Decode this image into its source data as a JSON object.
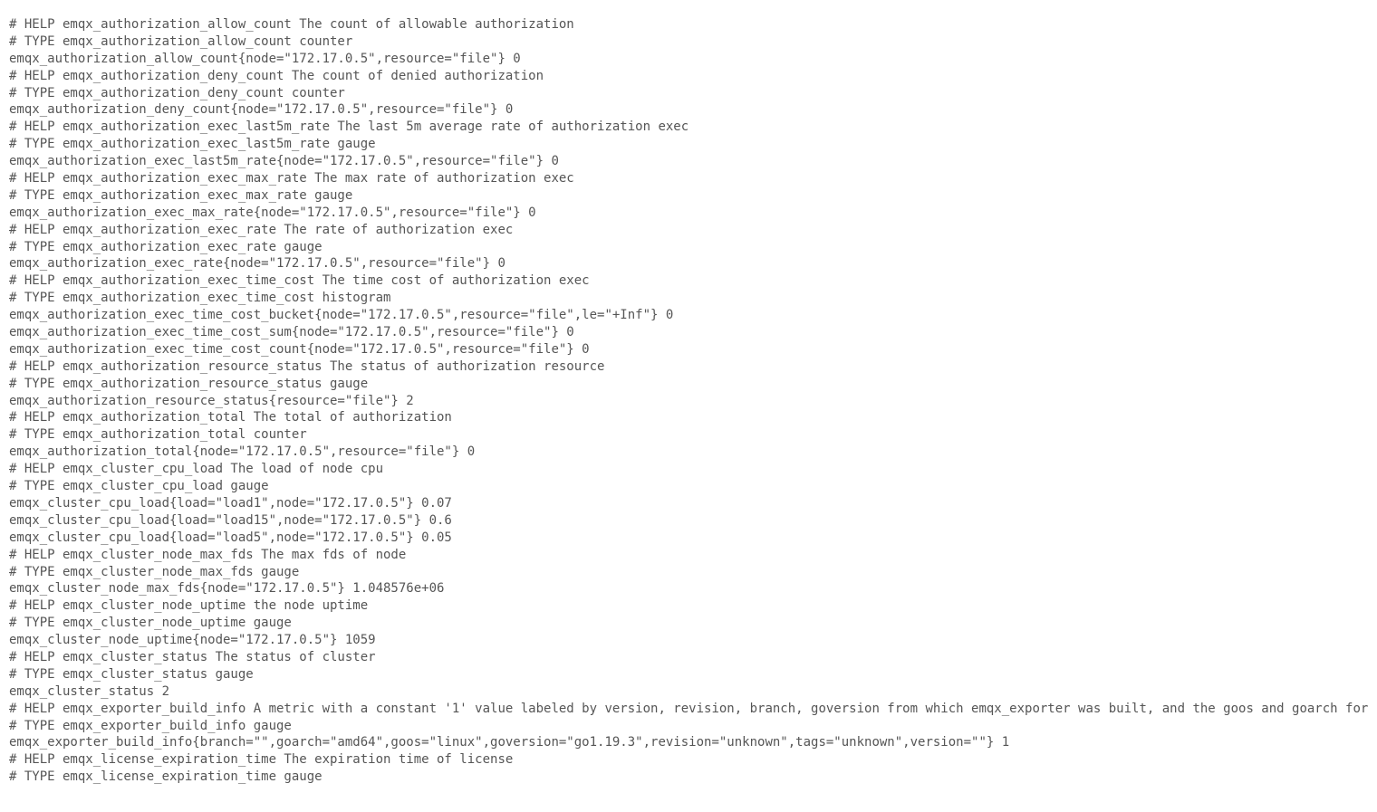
{
  "lines": [
    "# HELP emqx_authorization_allow_count The count of allowable authorization",
    "# TYPE emqx_authorization_allow_count counter",
    "emqx_authorization_allow_count{node=\"172.17.0.5\",resource=\"file\"} 0",
    "# HELP emqx_authorization_deny_count The count of denied authorization",
    "# TYPE emqx_authorization_deny_count counter",
    "emqx_authorization_deny_count{node=\"172.17.0.5\",resource=\"file\"} 0",
    "# HELP emqx_authorization_exec_last5m_rate The last 5m average rate of authorization exec",
    "# TYPE emqx_authorization_exec_last5m_rate gauge",
    "emqx_authorization_exec_last5m_rate{node=\"172.17.0.5\",resource=\"file\"} 0",
    "# HELP emqx_authorization_exec_max_rate The max rate of authorization exec",
    "# TYPE emqx_authorization_exec_max_rate gauge",
    "emqx_authorization_exec_max_rate{node=\"172.17.0.5\",resource=\"file\"} 0",
    "# HELP emqx_authorization_exec_rate The rate of authorization exec",
    "# TYPE emqx_authorization_exec_rate gauge",
    "emqx_authorization_exec_rate{node=\"172.17.0.5\",resource=\"file\"} 0",
    "# HELP emqx_authorization_exec_time_cost The time cost of authorization exec",
    "# TYPE emqx_authorization_exec_time_cost histogram",
    "emqx_authorization_exec_time_cost_bucket{node=\"172.17.0.5\",resource=\"file\",le=\"+Inf\"} 0",
    "emqx_authorization_exec_time_cost_sum{node=\"172.17.0.5\",resource=\"file\"} 0",
    "emqx_authorization_exec_time_cost_count{node=\"172.17.0.5\",resource=\"file\"} 0",
    "# HELP emqx_authorization_resource_status The status of authorization resource",
    "# TYPE emqx_authorization_resource_status gauge",
    "emqx_authorization_resource_status{resource=\"file\"} 2",
    "# HELP emqx_authorization_total The total of authorization",
    "# TYPE emqx_authorization_total counter",
    "emqx_authorization_total{node=\"172.17.0.5\",resource=\"file\"} 0",
    "# HELP emqx_cluster_cpu_load The load of node cpu",
    "# TYPE emqx_cluster_cpu_load gauge",
    "emqx_cluster_cpu_load{load=\"load1\",node=\"172.17.0.5\"} 0.07",
    "emqx_cluster_cpu_load{load=\"load15\",node=\"172.17.0.5\"} 0.6",
    "emqx_cluster_cpu_load{load=\"load5\",node=\"172.17.0.5\"} 0.05",
    "# HELP emqx_cluster_node_max_fds The max fds of node",
    "# TYPE emqx_cluster_node_max_fds gauge",
    "emqx_cluster_node_max_fds{node=\"172.17.0.5\"} 1.048576e+06",
    "# HELP emqx_cluster_node_uptime the node uptime",
    "# TYPE emqx_cluster_node_uptime gauge",
    "emqx_cluster_node_uptime{node=\"172.17.0.5\"} 1059",
    "# HELP emqx_cluster_status The status of cluster",
    "# TYPE emqx_cluster_status gauge",
    "emqx_cluster_status 2",
    "# HELP emqx_exporter_build_info A metric with a constant '1' value labeled by version, revision, branch, goversion from which emqx_exporter was built, and the goos and goarch for",
    "# TYPE emqx_exporter_build_info gauge",
    "emqx_exporter_build_info{branch=\"\",goarch=\"amd64\",goos=\"linux\",goversion=\"go1.19.3\",revision=\"unknown\",tags=\"unknown\",version=\"\"} 1",
    "# HELP emqx_license_expiration_time The expiration time of license",
    "# TYPE emqx_license_expiration_time gauge"
  ]
}
